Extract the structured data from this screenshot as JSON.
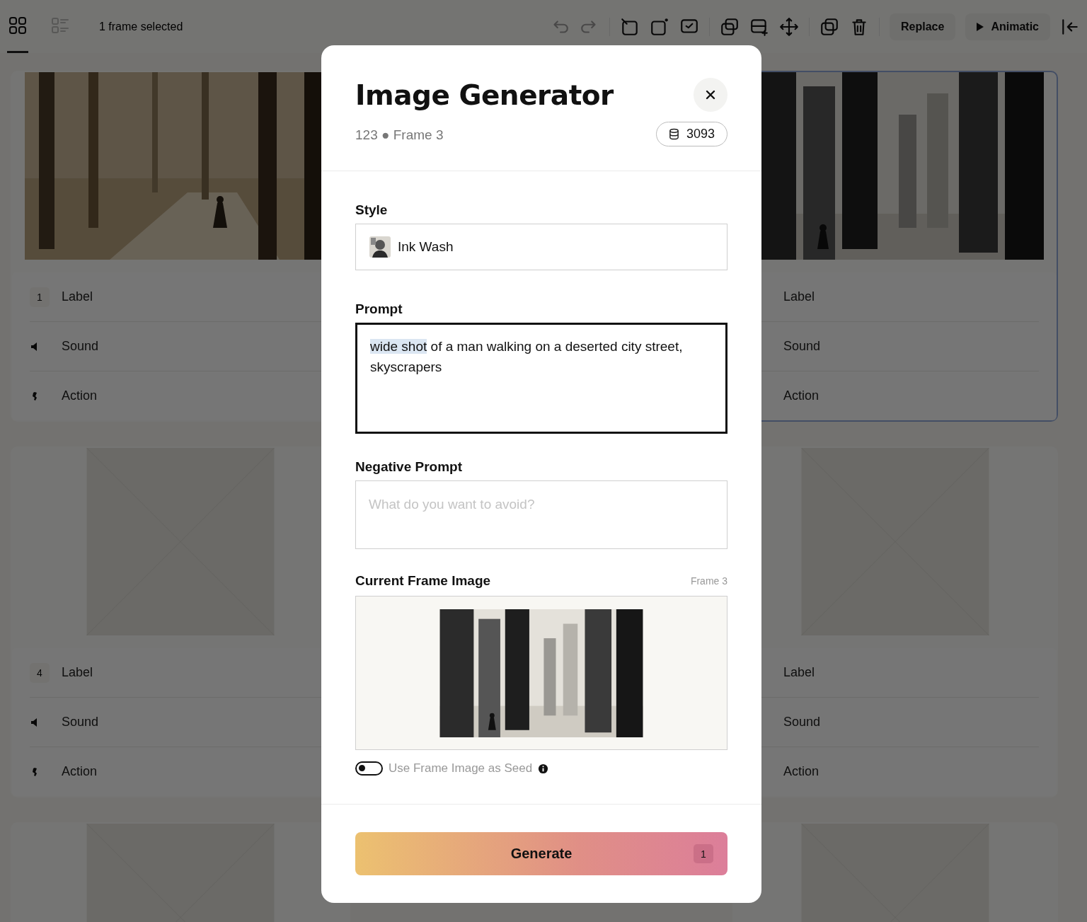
{
  "toolbar": {
    "views": [
      {
        "kind": "grid",
        "selected": true
      },
      {
        "kind": "list",
        "selected": false
      }
    ],
    "selection_text": "1 frame selected",
    "buttons": [
      {
        "kind": "text",
        "label": "Replace"
      },
      {
        "kind": "play",
        "label": "Animatic"
      }
    ]
  },
  "frames": [
    {
      "selected": false,
      "image": {
        "kind": "forest"
      },
      "rows": [
        {
          "kind": "number",
          "number": "1",
          "text": "Label"
        },
        {
          "kind": "sound",
          "text": "Sound"
        },
        {
          "kind": "action",
          "text": "Action"
        }
      ]
    },
    {
      "selected": true,
      "image": {
        "kind": "city"
      },
      "rows": [
        {
          "text": "Label"
        },
        {
          "text": "Sound"
        },
        {
          "text": "Action"
        }
      ]
    },
    {
      "selected": false,
      "image": {
        "kind": "placeholder"
      },
      "rows": [
        {
          "kind": "number",
          "number": "4",
          "text": "Label"
        },
        {
          "kind": "sound",
          "text": "Sound"
        },
        {
          "kind": "action",
          "text": "Action"
        }
      ]
    },
    {
      "selected": false,
      "image": {
        "kind": "placeholder"
      },
      "rows": [
        {
          "text": "Label"
        },
        {
          "text": "Sound"
        },
        {
          "text": "Action"
        }
      ]
    },
    {
      "selected": false,
      "image": {
        "kind": "placeholder"
      }
    },
    {
      "selected": false,
      "image": {
        "kind": "placeholder"
      }
    }
  ],
  "dialog": {
    "title": "Image Generator",
    "subtitle": "123 ● Frame 3",
    "credits": "3093",
    "style": {
      "label": "Style",
      "value": "Ink Wash"
    },
    "prompt": {
      "label": "Prompt",
      "focused": true,
      "selected_text": "wide shot",
      "value": " of a man walking on a deserted city street, skyscrapers"
    },
    "negative_prompt": {
      "label": "Negative Prompt",
      "placeholder": "What do you want to avoid?"
    },
    "frame_image": {
      "label": "Current Frame Image",
      "frame": "Frame 3",
      "kind": "picture"
    },
    "seed_toggle": {
      "label": "Use Frame Image as Seed",
      "on": false
    },
    "generate": {
      "label": "Generate",
      "count": "1"
    }
  }
}
